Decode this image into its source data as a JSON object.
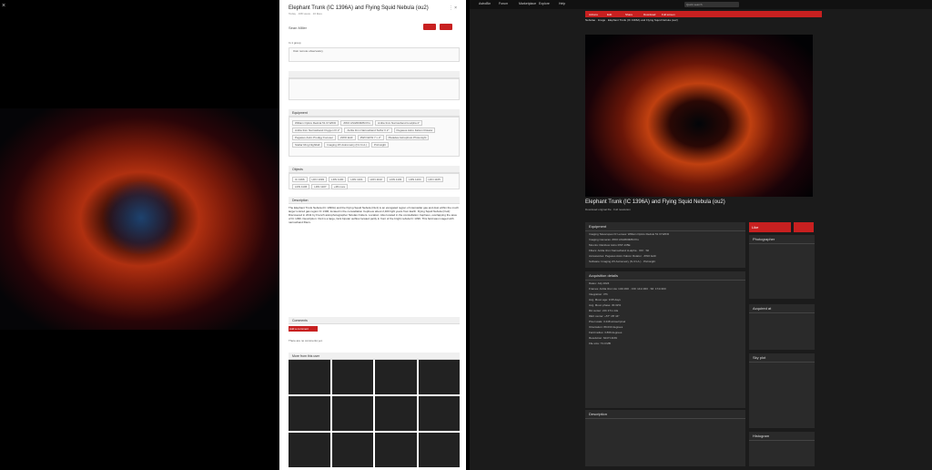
{
  "viewer": {
    "close": "×"
  },
  "panel": {
    "title": "Elephant Trunk (IC 1396A) and Flying Squid Nebula (ou2)",
    "meta": "Today · 168 views · 10 likes",
    "tools": "⋮ ×",
    "user": "Sean Miller",
    "group": "In 1 group",
    "observatory": "Own remote observatory",
    "equip_label": "Equipment",
    "equip_rows": [
      "William Optics Redcat 51 III WIFD",
      "ZWO ASI2600MM Pro",
      "Antlia 3nm Narrowband H-alpha 2\"",
      "Antlia 3nm Narrowband Oxygen III 2\"",
      "Antlia 3nm Narrowband Sulfur II 2\"",
      "Pegasus Astro Falcon Rotator",
      "Pegasus Astro Prodigy Focuser",
      "ZWO EAF",
      "ZWO EFW 7 x 2\"",
      "Pleiades Astrophoto Photonight",
      "Stellar Ring Nightfall",
      "Imaging ZX Astrometry (N.I.N.A.)",
      "PixInsight"
    ],
    "objects_label": "Objects",
    "objects": [
      "IC 1396",
      "LDN 1093",
      "LDN 1100",
      "LDN 1101",
      "LDN 1102",
      "LDN 1103",
      "LDN 1104",
      "LDN 1105",
      "LDN 1106",
      "LDN 1107",
      "+48 more"
    ],
    "description_label": "Description",
    "description": "The Elephant Trunk Nebula (IC 1396A) and the Flying Squid Nebula (Ou4) is an elongated region of interstellar gas and dust within the much larger ionized gas region IC 1396, located in the constellation Cepheus about 2,400 light years from Earth. Flying Squid Nebula (Ou4): Discovered in 2011 by French astrophotographer Nicolas Outters. Location: Also located in the constellation Cepheus, overlapping the area of IC 1396. Description: Ou4 is a large, faint bipolar outflow located partly in front of the bright nebula IC 1396. This field was imaged with narrowband filters.",
    "comments_label": "Comments",
    "add_comment": "Add a comment",
    "no_comments": "There are no comments yet.",
    "more_label": "More from this user"
  },
  "site": {
    "nav": [
      "AstroBin",
      "Forum",
      "Marketplace",
      "Explore",
      "Help"
    ],
    "search_placeholder": "Quick search",
    "redbar": [
      "Actions",
      "Edit",
      "Share",
      "Download",
      "Full screen"
    ],
    "crumb": "Nebulae · Image · Elephant Trunk (IC 1396A) and Flying Squid Nebula (ou2)",
    "title": "Elephant Trunk (IC 1396A) and Flying Squid Nebula (ou2)",
    "sub1": "Download original file · Full resolution",
    "like": "Like",
    "equipment_label": "Equipment",
    "equipment_rows": [
      "Imaging Telescopes Or Lenses: William Optics Redcat 51 III WIFD",
      "Imaging Cameras: ZWO ASI2600MM Pro",
      "Mounts: Rainbow Astro RST-135E",
      "Filters: Antlia 3nm Narrowband H-alpha · OIII · SII",
      "Accessories: Pegasus Astro Falcon Rotator · ZWO EAF",
      "Software: Imaging ZX Astrometry (N.I.N.A.) · PixInsight"
    ],
    "acq_label": "Acquisition details",
    "acq_rows": [
      "Dates: July 2024",
      "Frames: Antlia 3nm Ha: 134×300 · OIII: 141×300 · SII: 174×300",
      "Integration: 37h",
      "Avg. Moon age: 9.95 days",
      "Avg. Moon phase: 30.32%",
      "RA center: 21h 37m 14s",
      "DEC center: +57° 28' 44\"",
      "Pixel scale: 3.448 arcsec/pixel",
      "Orientation: 89.033 degrees",
      "Field radius: 3.869 degrees"
    ],
    "resolution": "Resolution: 6247×4169",
    "filesize": "File size: 73.0 MB",
    "description_label": "Description",
    "photographer_label": "Photographer",
    "acquired_label": "Acquired at",
    "sky_label": "Sky plot",
    "histogram_label": "Histogram"
  }
}
